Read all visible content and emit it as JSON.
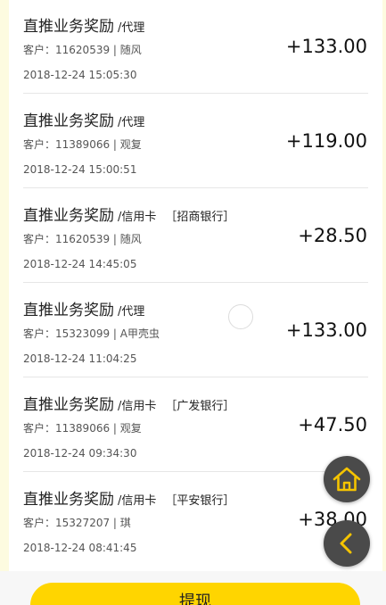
{
  "records": [
    {
      "title": "直推业务奖励",
      "category": "/代理",
      "bank": "",
      "client_prefix": "客户：",
      "client_info": "11620539 | 随风",
      "time": "2018-12-24 15:05:30",
      "amount": "+133.00"
    },
    {
      "title": "直推业务奖励",
      "category": "/代理",
      "bank": "",
      "client_prefix": "客户：",
      "client_info": "11389066 | 观复",
      "time": "2018-12-24 15:00:51",
      "amount": "+119.00"
    },
    {
      "title": "直推业务奖励",
      "category": "/信用卡",
      "bank": "［招商银行］",
      "client_prefix": "客户：",
      "client_info": "11620539 | 随风",
      "time": "2018-12-24 14:45:05",
      "amount": "+28.50"
    },
    {
      "title": "直推业务奖励",
      "category": "/代理",
      "bank": "",
      "client_prefix": "客户：",
      "client_info": "15323099 | A甲壳虫",
      "time": "2018-12-24 11:04:25",
      "amount": "+133.00"
    },
    {
      "title": "直推业务奖励",
      "category": "/信用卡",
      "bank": "［广发银行］",
      "client_prefix": "客户：",
      "client_info": "11389066 | 观复",
      "time": "2018-12-24 09:34:30",
      "amount": "+47.50"
    },
    {
      "title": "直推业务奖励",
      "category": "/信用卡",
      "bank": "［平安银行］",
      "client_prefix": "客户：",
      "client_info": "15327207 | 琪",
      "time": "2018-12-24 08:41:45",
      "amount": "+38.00"
    }
  ],
  "floating_buttons": {
    "home_icon": "home-icon",
    "back_icon": "chevron-left-icon"
  },
  "bottom": {
    "withdraw_label": "提现"
  },
  "colors": {
    "accent": "#ffd500",
    "fab_background": "#4a4a4a",
    "icon_color": "#f5c400"
  }
}
